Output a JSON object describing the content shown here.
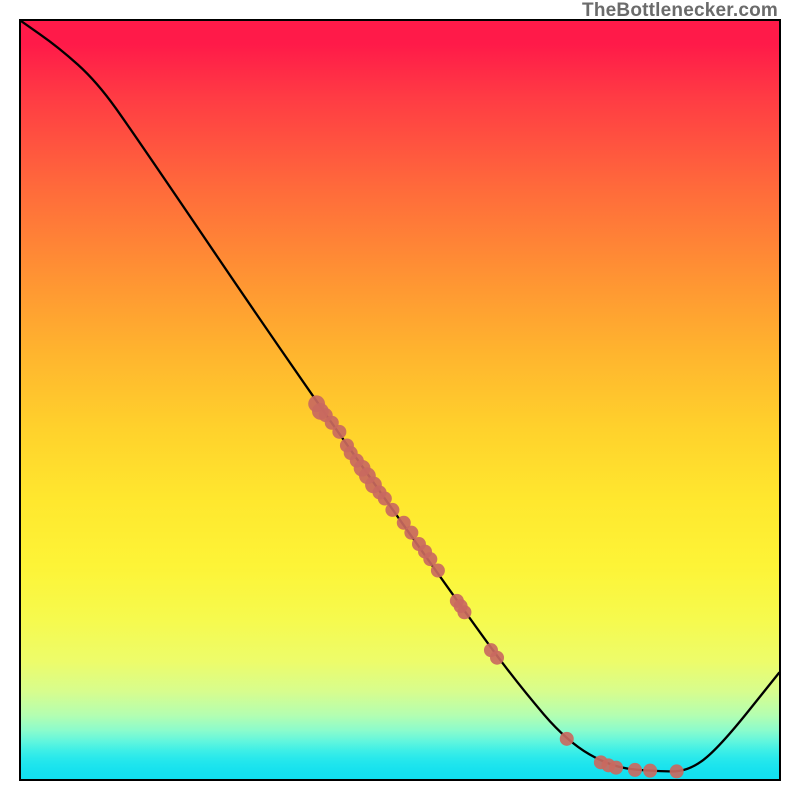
{
  "watermark": "TheBottlenecker.com",
  "chart_data": {
    "type": "line",
    "title": "",
    "xlabel": "",
    "ylabel": "",
    "xlim": [
      0,
      100
    ],
    "ylim": [
      0,
      100
    ],
    "grid": false,
    "series": [
      {
        "name": "curve",
        "color": "#000000",
        "points": [
          {
            "x": 0,
            "y": 100
          },
          {
            "x": 5,
            "y": 96.5
          },
          {
            "x": 10,
            "y": 92
          },
          {
            "x": 15,
            "y": 85
          },
          {
            "x": 36,
            "y": 54
          },
          {
            "x": 60,
            "y": 20
          },
          {
            "x": 66,
            "y": 12
          },
          {
            "x": 72,
            "y": 5
          },
          {
            "x": 78,
            "y": 1.5
          },
          {
            "x": 84,
            "y": 1
          },
          {
            "x": 88,
            "y": 1
          },
          {
            "x": 92,
            "y": 4
          },
          {
            "x": 100,
            "y": 14
          }
        ]
      }
    ],
    "scatter": {
      "name": "dots",
      "color": "#c9695f",
      "points": [
        {
          "x": 39.0,
          "y": 49.5,
          "r": 1.2
        },
        {
          "x": 39.5,
          "y": 48.5,
          "r": 1.2
        },
        {
          "x": 40.2,
          "y": 48.0,
          "r": 1.0
        },
        {
          "x": 41.0,
          "y": 47.0,
          "r": 1.0
        },
        {
          "x": 42.0,
          "y": 45.8,
          "r": 1.0
        },
        {
          "x": 43.0,
          "y": 44.0,
          "r": 1.0
        },
        {
          "x": 43.5,
          "y": 43.0,
          "r": 1.0
        },
        {
          "x": 44.3,
          "y": 42.0,
          "r": 1.0
        },
        {
          "x": 45.0,
          "y": 41.0,
          "r": 1.2
        },
        {
          "x": 45.7,
          "y": 40.0,
          "r": 1.2
        },
        {
          "x": 46.5,
          "y": 38.8,
          "r": 1.2
        },
        {
          "x": 47.3,
          "y": 37.8,
          "r": 1.0
        },
        {
          "x": 48.0,
          "y": 37.0,
          "r": 1.0
        },
        {
          "x": 49.0,
          "y": 35.5,
          "r": 1.0
        },
        {
          "x": 50.5,
          "y": 33.8,
          "r": 1.0
        },
        {
          "x": 51.5,
          "y": 32.5,
          "r": 1.0
        },
        {
          "x": 52.5,
          "y": 31.0,
          "r": 1.0
        },
        {
          "x": 53.3,
          "y": 30.0,
          "r": 1.0
        },
        {
          "x": 54.0,
          "y": 29.0,
          "r": 1.0
        },
        {
          "x": 55.0,
          "y": 27.5,
          "r": 1.0
        },
        {
          "x": 57.5,
          "y": 23.5,
          "r": 1.0
        },
        {
          "x": 58.0,
          "y": 22.8,
          "r": 1.0
        },
        {
          "x": 58.5,
          "y": 22.0,
          "r": 1.0
        },
        {
          "x": 62.0,
          "y": 17.0,
          "r": 1.0
        },
        {
          "x": 62.8,
          "y": 16.0,
          "r": 1.0
        },
        {
          "x": 72.0,
          "y": 5.3,
          "r": 1.0
        },
        {
          "x": 76.5,
          "y": 2.2,
          "r": 1.0
        },
        {
          "x": 77.5,
          "y": 1.8,
          "r": 1.0
        },
        {
          "x": 78.5,
          "y": 1.5,
          "r": 1.0
        },
        {
          "x": 81.0,
          "y": 1.2,
          "r": 1.0
        },
        {
          "x": 83.0,
          "y": 1.1,
          "r": 1.0
        },
        {
          "x": 86.5,
          "y": 1.0,
          "r": 1.0
        }
      ]
    }
  }
}
